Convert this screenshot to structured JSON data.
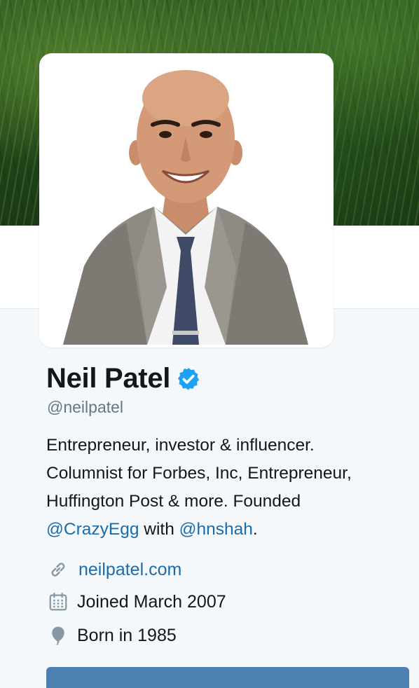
{
  "profile": {
    "name": "Neil Patel",
    "handle": "@neilpatel",
    "verified": true,
    "bio": {
      "line1": "Entrepreneur, investor & influencer.",
      "line2": "Columnist for Forbes, Inc, Entrepreneur,",
      "line3": "Huffington Post & more. Founded",
      "mention1": "@CrazyEgg",
      "with_text": " with ",
      "mention2": "@hnshah",
      "end": "."
    },
    "website": "neilpatel.com",
    "joined": "Joined March 2007",
    "born": "Born in 1985"
  },
  "icons": {
    "verified": "verified-badge-icon",
    "link": "link-icon",
    "calendar": "calendar-icon",
    "balloon": "balloon-icon"
  },
  "colors": {
    "link": "#1b6cad",
    "verified": "#1da1f2",
    "muted": "#657786",
    "background": "#f5f8fa"
  }
}
